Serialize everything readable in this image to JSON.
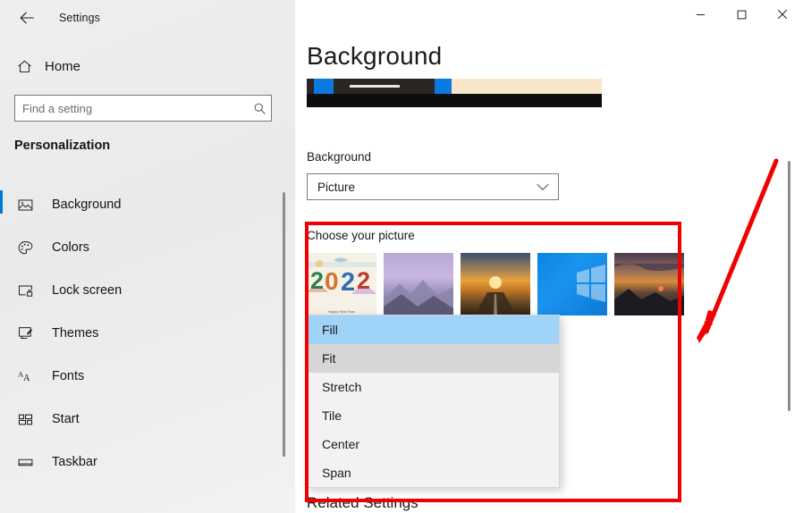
{
  "window": {
    "title": "Settings",
    "back_icon": "back-arrow-icon",
    "minimize_label": "─",
    "maximize_label": "□",
    "close_label": "✕"
  },
  "sidebar": {
    "home": {
      "label": "Home",
      "icon": "home-icon"
    },
    "search": {
      "placeholder": "Find a setting",
      "value": "",
      "icon": "search-icon"
    },
    "category": "Personalization",
    "items": [
      {
        "label": "Background",
        "icon": "picture-icon",
        "selected": true
      },
      {
        "label": "Colors",
        "icon": "palette-icon",
        "selected": false
      },
      {
        "label": "Lock screen",
        "icon": "lock-screen-icon",
        "selected": false
      },
      {
        "label": "Themes",
        "icon": "themes-brush-icon",
        "selected": false
      },
      {
        "label": "Fonts",
        "icon": "fonts-aa-icon",
        "selected": false
      },
      {
        "label": "Start",
        "icon": "start-tiles-icon",
        "selected": false
      },
      {
        "label": "Taskbar",
        "icon": "taskbar-icon",
        "selected": false
      }
    ]
  },
  "main": {
    "page_title": "Background",
    "background_label": "Background",
    "background_value": "Picture",
    "background_chevron": "chevron-down-icon",
    "choose_picture_label": "Choose your picture",
    "thumbnails": [
      {
        "name": "2022 Happy New Year",
        "caption": "Happy New Year",
        "selected": true
      },
      {
        "name": "Purple mountains",
        "caption": "",
        "selected": false
      },
      {
        "name": "Sunset road",
        "caption": "",
        "selected": false
      },
      {
        "name": "Windows 10 blue",
        "caption": "",
        "selected": false
      },
      {
        "name": "Dark sunset mountains",
        "caption": "",
        "selected": false
      }
    ],
    "fit_dropdown": {
      "options": [
        "Fill",
        "Fit",
        "Stretch",
        "Tile",
        "Center",
        "Span"
      ],
      "selected": "Fill",
      "hovered": "Fit"
    },
    "related_settings_label": "Related Settings"
  },
  "annotations": {
    "highlight_box_color": "#f00000",
    "arrow_color": "#f00000"
  }
}
